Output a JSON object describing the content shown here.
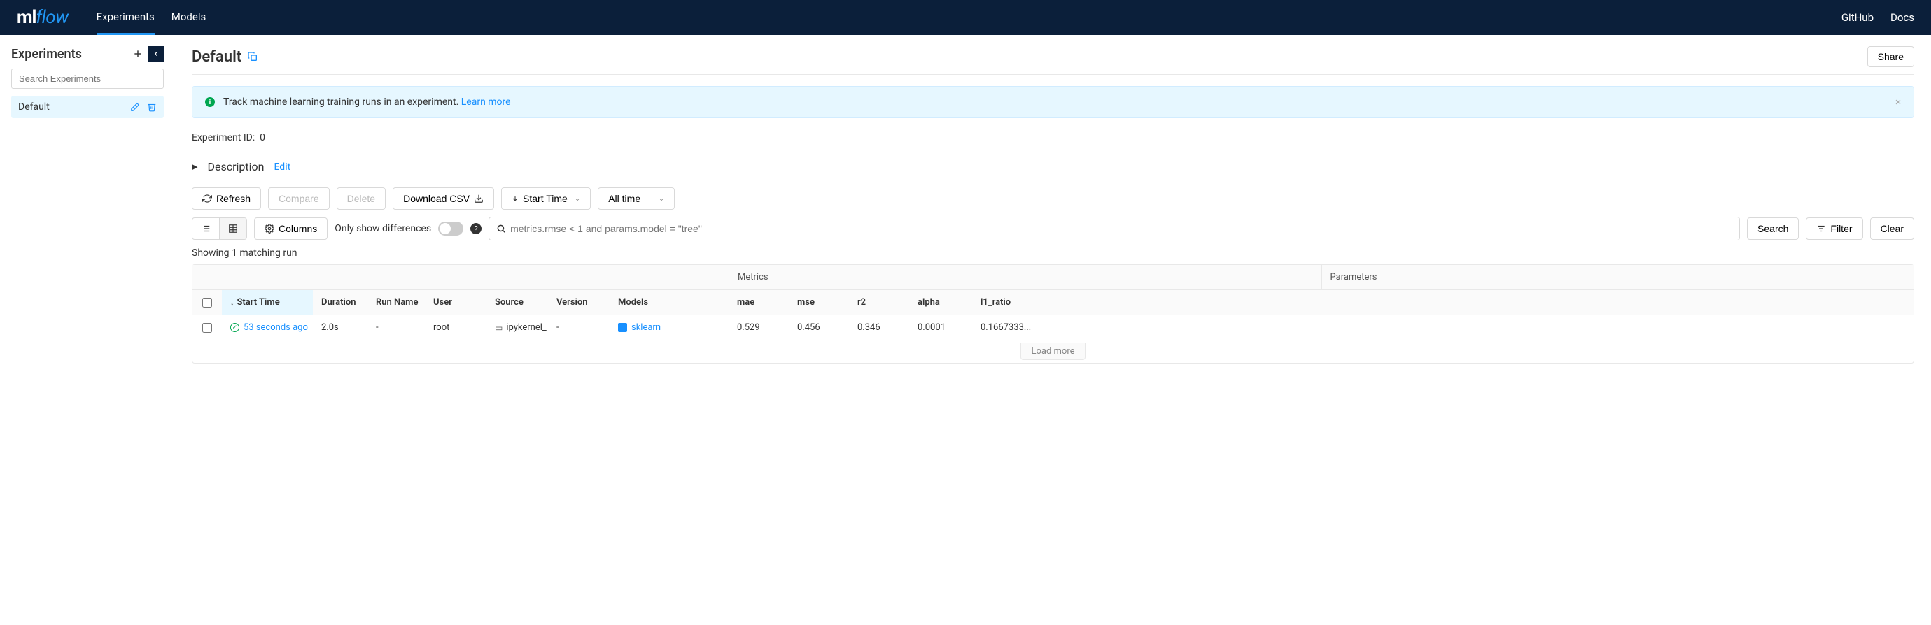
{
  "header": {
    "logo_ml": "ml",
    "logo_flow": "flow",
    "nav": {
      "experiments": "Experiments",
      "models": "Models"
    },
    "right": {
      "github": "GitHub",
      "docs": "Docs"
    }
  },
  "sidebar": {
    "title": "Experiments",
    "search_placeholder": "Search Experiments",
    "items": [
      {
        "name": "Default"
      }
    ]
  },
  "page": {
    "title": "Default",
    "share": "Share",
    "banner_text": "Track machine learning training runs in an experiment. ",
    "banner_link": "Learn more",
    "experiment_id_label": "Experiment ID:",
    "experiment_id_value": "0",
    "description_label": "Description",
    "description_edit": "Edit"
  },
  "toolbar": {
    "refresh": "Refresh",
    "compare": "Compare",
    "delete": "Delete",
    "download_csv": "Download CSV",
    "sort_by": "Start Time",
    "time_filter": "All time",
    "columns": "Columns",
    "only_diff": "Only show differences",
    "search_placeholder": "metrics.rmse < 1 and params.model = \"tree\"",
    "search": "Search",
    "filter": "Filter",
    "clear": "Clear"
  },
  "table": {
    "showing": "Showing 1 matching run",
    "group_metrics": "Metrics",
    "group_params": "Parameters",
    "headers": {
      "start_time": "Start Time",
      "duration": "Duration",
      "run_name": "Run Name",
      "user": "User",
      "source": "Source",
      "version": "Version",
      "models": "Models",
      "mae": "mae",
      "mse": "mse",
      "r2": "r2",
      "alpha": "alpha",
      "l1_ratio": "l1_ratio"
    },
    "rows": [
      {
        "start_time": "53 seconds ago",
        "duration": "2.0s",
        "run_name": "-",
        "user": "root",
        "source": "ipykernel_",
        "version": "-",
        "models": "sklearn",
        "mae": "0.529",
        "mse": "0.456",
        "r2": "0.346",
        "alpha": "0.0001",
        "l1_ratio": "0.1667333..."
      }
    ],
    "load_more": "Load more"
  }
}
